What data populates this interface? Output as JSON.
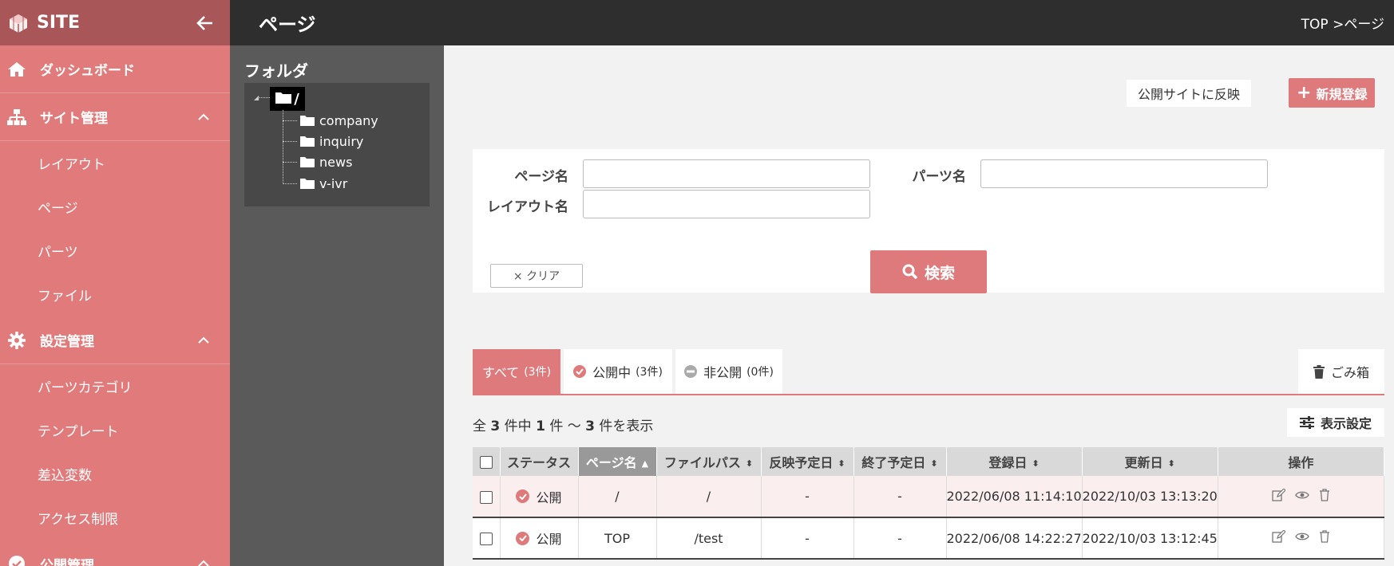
{
  "sidebar": {
    "brand": "SITE",
    "items": [
      {
        "label": "ダッシュボード",
        "type": "main",
        "icon": "home-icon"
      },
      {
        "label": "サイト管理",
        "type": "main",
        "icon": "sitemap-icon",
        "expanded": true
      },
      {
        "label": "レイアウト",
        "type": "sub"
      },
      {
        "label": "ページ",
        "type": "sub"
      },
      {
        "label": "パーツ",
        "type": "sub"
      },
      {
        "label": "ファイル",
        "type": "sub"
      },
      {
        "label": "設定管理",
        "type": "main",
        "icon": "gear-icon",
        "expanded": true
      },
      {
        "label": "パーツカテゴリ",
        "type": "sub"
      },
      {
        "label": "テンプレート",
        "type": "sub"
      },
      {
        "label": "差込変数",
        "type": "sub"
      },
      {
        "label": "アクセス制限",
        "type": "sub"
      },
      {
        "label": "公開管理",
        "type": "main",
        "icon": "check-circle-icon",
        "expanded": true
      }
    ]
  },
  "header": {
    "title": "ページ",
    "breadcrumb": "TOP >ページ"
  },
  "folders": {
    "title": "フォルダ",
    "root": "/",
    "children": [
      "company",
      "inquiry",
      "news",
      "v-ivr"
    ]
  },
  "actions": {
    "publish": "公開サイトに反映",
    "new": "新規登録"
  },
  "search": {
    "page_name_label": "ページ名",
    "parts_name_label": "パーツ名",
    "layout_name_label": "レイアウト名",
    "page_name_value": "",
    "parts_name_value": "",
    "layout_name_value": "",
    "clear": "× クリア",
    "search": "検索"
  },
  "tabs": {
    "all": {
      "label": "すべて",
      "count": "(3件)"
    },
    "published": {
      "label": "公開中",
      "count": "(3件)"
    },
    "unpublished": {
      "label": "非公開",
      "count": "(0件)"
    },
    "trash": "ごみ箱"
  },
  "summary": {
    "prefix": "全",
    "total": "3",
    "mid1": "件中",
    "from": "1",
    "mid2": "件 ～",
    "to": "3",
    "suffix": "件を表示"
  },
  "display_settings": "表示設定",
  "table": {
    "columns": [
      "ステータス",
      "ページ名",
      "ファイルパス",
      "反映予定日",
      "終了予定日",
      "登録日",
      "更新日",
      "操作"
    ],
    "rows": [
      {
        "status": "公開",
        "page_name": "/",
        "file_path": "/",
        "publish_date": "-",
        "end_date": "-",
        "created": "2022/06/08 11:14:10",
        "updated": "2022/10/03 13:13:20"
      },
      {
        "status": "公開",
        "page_name": "TOP",
        "file_path": "/test",
        "publish_date": "-",
        "end_date": "-",
        "created": "2022/06/08 14:22:27",
        "updated": "2022/10/03 13:12:45"
      }
    ]
  },
  "colors": {
    "sidebar": "#e07a7b",
    "brand_bar": "#a85658",
    "accent": "#de7a7c",
    "header": "#2e2e2e",
    "folder_panel": "#5a5a5a"
  }
}
